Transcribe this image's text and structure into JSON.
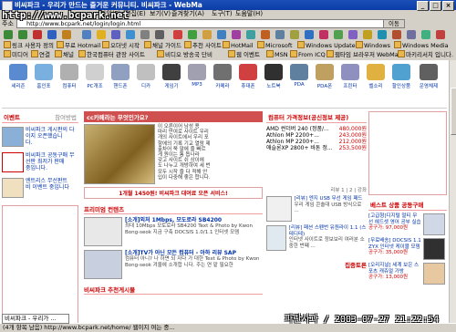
{
  "window": {
    "title": "비씨파크 - 우리가 만드는 즐거운 커뮤니티. 비씨파크 - WebMa",
    "watermark_url": "http://www.bcpark.net"
  },
  "menu": [
    "파일(F)",
    "편집(E)",
    "보기(V)",
    "즐겨찾기(A)",
    "도구(T)",
    "도움말(H)"
  ],
  "address": {
    "label": "주소",
    "url": "http://www.bcpark.net/login/login.html",
    "go_label": "이동"
  },
  "toolbar_text": [
    "검색",
    "즐겨찾기",
    "미디어"
  ],
  "links_row1": [
    "링크 사용자 정의",
    "무료 Hotmail",
    "오더넷 시작",
    "채널 가이드",
    "추천 사이트",
    "HotMail",
    "Microsoft",
    "Windows Update",
    "Windows",
    "Windows Media"
  ],
  "links_row2": [
    "미디어",
    "연결",
    "채널",
    "한국컴퓨터 관장 사이트",
    "비디오 방송국 단비",
    "웹 이벤트",
    "MSN",
    "From ICQ",
    "웹타임 브라우저 WebMa",
    "마키리서치 입니다."
  ],
  "site_icons": [
    "세리존",
    "홈인포",
    "컴퓨터",
    "PC개조",
    "핸드폰",
    "디카",
    "게임기",
    "MP3",
    "카메라",
    "휴대폰",
    "노트북",
    "PDA",
    "PDA폰",
    "프린터",
    "벨소리",
    "할인상품",
    "운영체제"
  ],
  "left_col": {
    "header1": "이벤트",
    "more1": "참여방법",
    "items1": [
      "비씨파크 게시판의 다",
      "이지 오픈했습니",
      "다."
    ],
    "items2": [
      "비씨파크 공동구매 무",
      "선판 최저가 판매",
      "중입니다."
    ],
    "items3": [
      "엔트리스 무선판트",
      "비 이벤트 중입니다"
    ],
    "tab": "비씨파크 - 우리가 ..."
  },
  "mid_col": {
    "featured_title": "cc카페라는 무엇인가요?",
    "featured_text": [
      "이 오른이어 남성 용",
      "마리 만여로 사이트 우리",
      "개의 사이트에서 우리 포",
      "항에의 기록 기교 열람 제",
      "출차어 쭉 말에 즐 빠르",
      "게 원이는 통 돕나라",
      "갖고 사이트 쉬 상이에",
      "도 나누고 개방하여 세 번",
      "모두 시작 즐 다 적해 안",
      "입이 다중해 좋은 합니다."
    ],
    "banner": "1개월 1450원! 비씨파크 대여료 오픈 서비스!",
    "section2": "프리미엄 컨텐츠",
    "items": [
      {
        "title": "[소개]외처 1Mbps, 모도로라 SB4200",
        "desc": "최대 10Mbps 모토로라 SB4200 Text & Photo by Kwon Bong-seok 지금 구축 DOCSIS 1.0/1.1 인터넷 모뎀"
      },
      {
        "title": "[소개]TV가 아닌 모든 컴퓨터 - 아하 리뷰 SAP",
        "desc": "컴퓨터 아니? 나 하면 되 자다 가 대한 Text & Photo by Kwon Bong-seok 겨울에 소개합 니다. 주는 연 맡 필요한"
      }
    ],
    "section3": "비씨파크 추천게시물"
  },
  "right_col": {
    "header": "컴퓨터 가격정보(공신정보 제공)",
    "prices": [
      {
        "name": "AMD 썬더버 240 (정품/...",
        "price": "480,000원"
      },
      {
        "name": "Athlon MP 2200+...",
        "price": "243,000원"
      },
      {
        "name": "Athlon MP 2200+...",
        "price": "212,000원"
      },
      {
        "name": "애슬론XP 2800+ 바톤 정...",
        "price": "253,500원"
      }
    ],
    "review_label": "리뷰 1 | 2 | 강좌",
    "items": [
      {
        "title": "[리뷰] 엔지 USB 무선 게임 패드",
        "desc": "우리 게임 콘솔대 USB 방식으로 ..."
      },
      {
        "title": "[리뷰] 패션 스펜번 유원라이 1.1 (스테디테)",
        "desc": "인터넷 사이트로 정보보리 여러분 소중한 번째 ..."
      }
    ],
    "section": "집중토론"
  },
  "far_col": {
    "header": "베스트 상품 공동구매",
    "items": [
      {
        "name": "[고급형]디지털 멀티 무선 헤드셋 영어 공부 실습",
        "price": "공구가: 97,000원"
      },
      {
        "name": "[무료배송] DOCSIS 1.1 ZYX 인터넷 케이블 모뎀",
        "price": "공구가: 35,000원"
      },
      {
        "name": "[오리지널] 세계 보은 스포츠 캐쥬얼 가방",
        "price": "공구가: 13,000원"
      }
    ]
  },
  "status": "(4개 항목 남음) http://www.bcpark.net/home/ 웹이지 여는 중...",
  "datestamp": "파란사과 / 2003-07-27 21:22:54",
  "colors": {
    "titlebar": "#0b3da8",
    "accent_red": "#c00000",
    "link_blue": "#0033aa"
  }
}
